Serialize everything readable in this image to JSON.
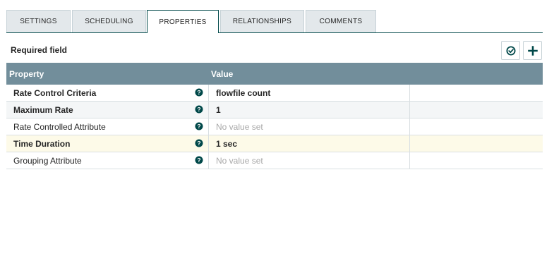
{
  "tabs": [
    {
      "label": "SETTINGS",
      "active": false
    },
    {
      "label": "SCHEDULING",
      "active": false
    },
    {
      "label": "PROPERTIES",
      "active": true
    },
    {
      "label": "RELATIONSHIPS",
      "active": false
    },
    {
      "label": "COMMENTS",
      "active": false
    }
  ],
  "required_field_label": "Required field",
  "toolbar": {
    "verify_icon": "check-circle-icon",
    "add_icon": "plus-icon"
  },
  "table": {
    "columns": [
      "Property",
      "Value"
    ],
    "rows": [
      {
        "name": "Rate Control Criteria",
        "value": "flowfile count",
        "required": true,
        "value_set": true
      },
      {
        "name": "Maximum Rate",
        "value": "1",
        "required": true,
        "value_set": true
      },
      {
        "name": "Rate Controlled Attribute",
        "value": "No value set",
        "required": false,
        "value_set": false
      },
      {
        "name": "Time Duration",
        "value": "1 sec",
        "required": true,
        "value_set": true
      },
      {
        "name": "Grouping Attribute",
        "value": "No value set",
        "required": false,
        "value_set": false
      }
    ]
  },
  "colors": {
    "header_bg": "#728e9b",
    "accent": "#004849",
    "highlight_row": "#fdfae8"
  }
}
